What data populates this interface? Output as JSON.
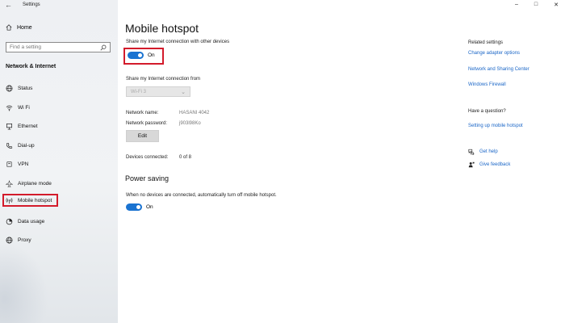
{
  "window": {
    "title": "Settings",
    "minimize": "–",
    "maximize": "□",
    "close": "✕"
  },
  "sidebar": {
    "home_label": "Home",
    "search_placeholder": "Find a setting",
    "section_title": "Network & Internet",
    "items": [
      {
        "label": "Status",
        "icon": "globe-icon"
      },
      {
        "label": "Wi Fi",
        "icon": "wifi-icon"
      },
      {
        "label": "Ethernet",
        "icon": "ethernet-icon"
      },
      {
        "label": "Dial-up",
        "icon": "phone-icon"
      },
      {
        "label": "VPN",
        "icon": "vpn-icon"
      },
      {
        "label": "Airplane mode",
        "icon": "airplane-icon"
      },
      {
        "label": "Mobile hotspot",
        "icon": "hotspot-icon",
        "active": true
      },
      {
        "label": "Data usage",
        "icon": "data-usage-icon"
      },
      {
        "label": "Proxy",
        "icon": "proxy-globe-icon"
      }
    ]
  },
  "main": {
    "title": "Mobile hotspot",
    "share_label": "Share my Internet connection with other devices",
    "share_toggle": "On",
    "share_from_label": "Share my Internet connection from",
    "share_from_value": "Wi-Fi 3",
    "network_name_key": "Network name:",
    "network_name_value": "HASANI 4042",
    "network_password_key": "Network password:",
    "network_password_value": "j903l98Ko",
    "edit_label": "Edit",
    "devices_key": "Devices connected:",
    "devices_value": "0 of 8",
    "power_saving_title": "Power saving",
    "power_saving_desc": "When no devices are connected, automatically turn off mobile hotspot.",
    "power_saving_toggle": "On"
  },
  "related": {
    "title": "Related settings",
    "links": [
      "Change adapter options",
      "Network and Sharing Center",
      "Windows Firewall"
    ],
    "question_title": "Have a question?",
    "question_link": "Setting up mobile hotspot",
    "get_help": "Get help",
    "give_feedback": "Give feedback"
  },
  "colors": {
    "accent": "#1a73d1",
    "link": "#1a66c7",
    "highlight": "#d31b2b"
  }
}
